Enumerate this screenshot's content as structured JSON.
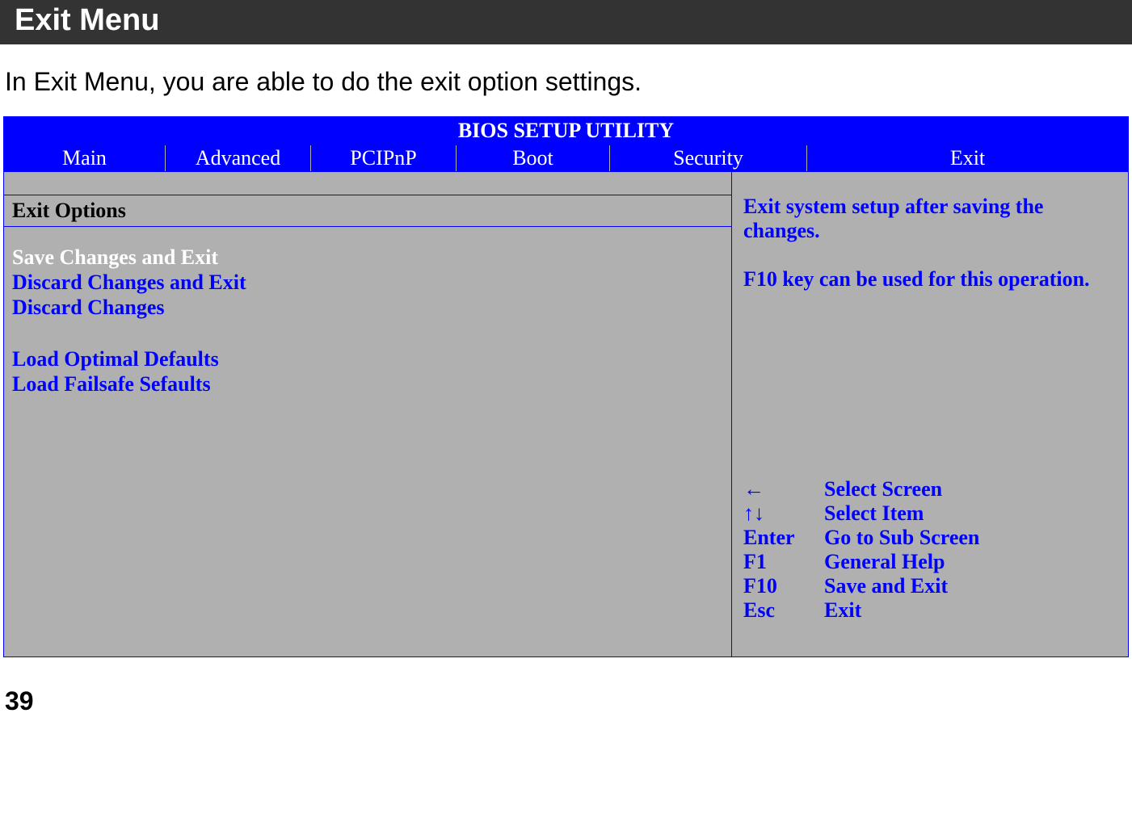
{
  "section_title": "Exit Menu",
  "intro": "In Exit Menu, you are able to do the exit option settings.",
  "bios": {
    "title": "BIOS SETUP UTILITY",
    "tabs": {
      "main": "Main",
      "advanced": "Advanced",
      "pcipnp": "PCIPnP",
      "boot": "Boot",
      "security": "Security",
      "exit": "Exit"
    },
    "options_title": "Exit Options",
    "options": {
      "save_exit": "Save Changes and Exit",
      "discard_exit": "Discard Changes and Exit",
      "discard": "Discard Changes",
      "load_optimal": "Load Optimal Defaults",
      "load_failsafe": "Load Failsafe Sefaults"
    },
    "help": {
      "line1": "Exit system setup after saving the changes.",
      "line2": "F10 key can be used for this operation."
    },
    "keys": {
      "left_key": "←",
      "left_desc": "Select Screen",
      "updown_key": "↑↓",
      "updown_desc": "Select Item",
      "enter_key": " Enter",
      "enter_desc": "Go to Sub Screen",
      "f1_key": "F1",
      "f1_desc": "General Help",
      "f10_key": "F10",
      "f10_desc": "Save and Exit",
      "esc_key": "Esc",
      "esc_desc": "Exit"
    }
  },
  "page_number": "39"
}
